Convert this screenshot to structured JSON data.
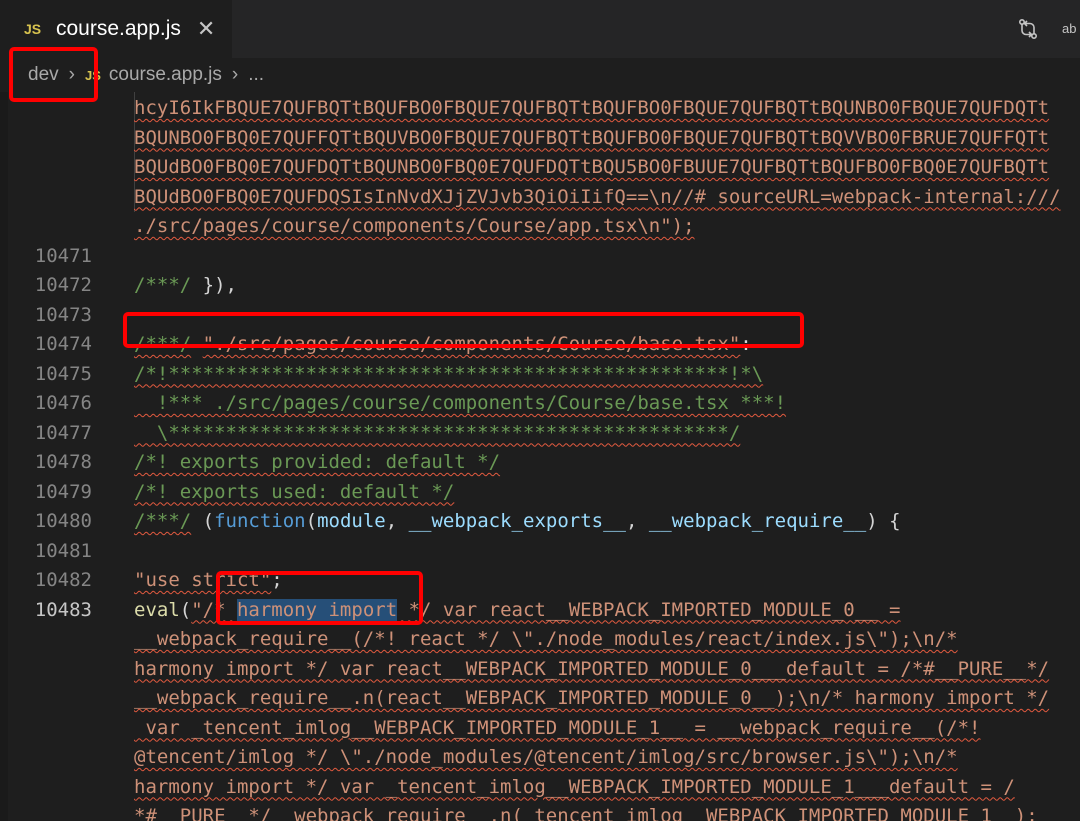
{
  "tab": {
    "badge": "JS",
    "title": "course.app.js",
    "close": "✕"
  },
  "actions": {
    "compare_icon": "git-compare-icon",
    "more_icon": "ab-icon",
    "more_label": "ab"
  },
  "breadcrumb": {
    "folder": "dev",
    "badge": "JS",
    "file": "course.app.js",
    "ellipsis": "..."
  },
  "lines": [
    {
      "num": "",
      "text": "hcyI6IkFBQUE7QUFBQTtBQUFBO0FBQUE7QUFBQTtBQUFBO0FBQUE7QUFBQTtBQUNBO0FBQUE7QUFDQTt"
    },
    {
      "num": "",
      "text": "BQUNBO0FBQ0E7QUFFQTtBQUVBO0FBQUE7QUFBQTtBQUFBO0FBQUE7QUFBQTtBQVVBO0FBRUE7QUFFQTt"
    },
    {
      "num": "",
      "text": "BQUdBO0FBQ0E7QUFDQTtBQUNBO0FBQ0E7QUFDQTtBQU5BO0FBUUE7QUFBQTtBQUFBO0FBQ0E7QUFBQTt"
    },
    {
      "num": "",
      "text": "BQUdBO0FBQ0E7QUFDQSIsInNvdXJjZVJvb3QiOiIifQ==\\n//# sourceURL=webpack-internal:///"
    },
    {
      "num": "",
      "text": "./src/pages/course/components/Course/app.tsx\\n\");"
    },
    {
      "num": "10471",
      "text": ""
    },
    {
      "num": "10472",
      "text": "/***/ }),"
    },
    {
      "num": "10473",
      "text": ""
    },
    {
      "num": "10474",
      "text": "/***/ \"./src/pages/course/components/Course/base.tsx\":"
    },
    {
      "num": "10475",
      "text": "/*!*************************************************!*\\"
    },
    {
      "num": "10476",
      "text": "  !*** ./src/pages/course/components/Course/base.tsx ***!"
    },
    {
      "num": "10477",
      "text": "  \\*************************************************/"
    },
    {
      "num": "10478",
      "text": "/*! exports provided: default */"
    },
    {
      "num": "10479",
      "text": "/*! exports used: default */"
    },
    {
      "num": "10480",
      "text": "/***/ (function(module, __webpack_exports__, __webpack_require__) {"
    },
    {
      "num": "10481",
      "text": ""
    },
    {
      "num": "10482",
      "text": "\"use strict\";"
    },
    {
      "num": "10483",
      "text": "eval(\"/* harmony import */ var react__WEBPACK_IMPORTED_MODULE_0__ ="
    },
    {
      "num": "",
      "text": "__webpack_require__(/*! react */ \\\"./node_modules/react/index.js\\\");\\n/*"
    },
    {
      "num": "",
      "text": "harmony import */ var react__WEBPACK_IMPORTED_MODULE_0___default = /*#__PURE__*/"
    },
    {
      "num": "",
      "text": "__webpack_require__.n(react__WEBPACK_IMPORTED_MODULE_0__);\\n/* harmony import */"
    },
    {
      "num": "",
      "text": " var _tencent_imlog__WEBPACK_IMPORTED_MODULE_1__ = __webpack_require__(/*!"
    },
    {
      "num": "",
      "text": "@tencent/imlog */ \\\"./node_modules/@tencent/imlog/src/browser.js\\\");\\n/*"
    },
    {
      "num": "",
      "text": "harmony import */ var _tencent_imlog__WEBPACK_IMPORTED_MODULE_1___default = /"
    },
    {
      "num": "",
      "text": "*#__PURE__*/__webpack_require__.n(_tencent_imlog__WEBPACK_IMPORTED_MODULE_1__);"
    }
  ]
}
